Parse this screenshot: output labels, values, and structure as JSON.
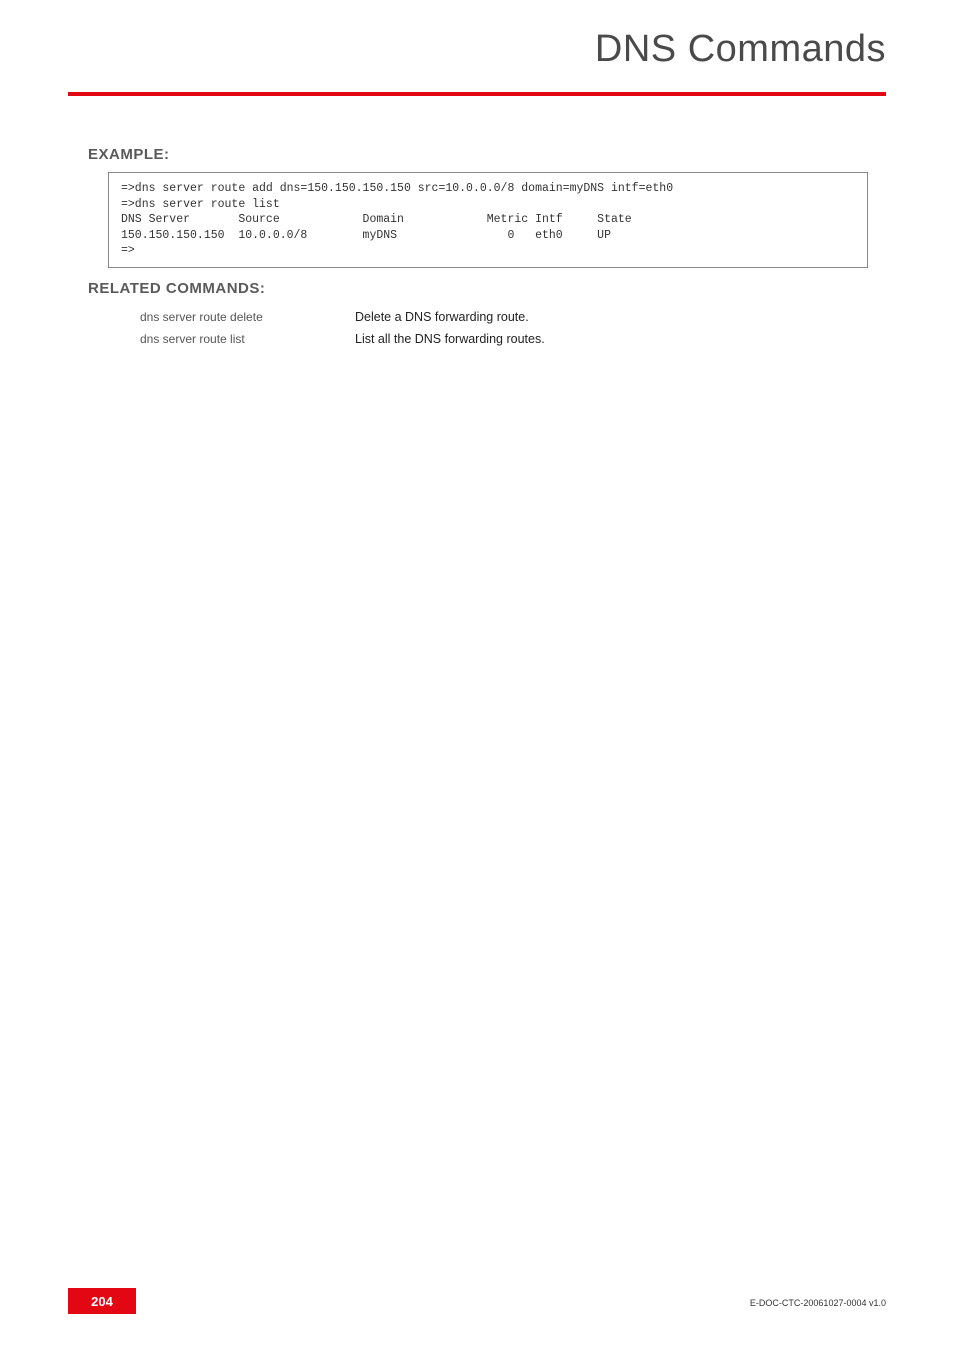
{
  "header": {
    "title": "DNS Commands"
  },
  "sections": {
    "example_heading": "EXAMPLE:",
    "related_heading": "RELATED COMMANDS:"
  },
  "code": {
    "line1": "=>dns server route add dns=150.150.150.150 src=10.0.0.0/8 domain=myDNS intf=eth0",
    "line2": "=>dns server route list",
    "line3": "DNS Server       Source            Domain            Metric Intf     State",
    "line4": "150.150.150.150  10.0.0.0/8        myDNS                0   eth0     UP",
    "line5": "=>"
  },
  "related": [
    {
      "cmd": "dns server route delete",
      "desc": "Delete a DNS forwarding route."
    },
    {
      "cmd": "dns server route list",
      "desc": "List all the DNS forwarding routes."
    }
  ],
  "footer": {
    "page_number": "204",
    "doc_id": "E-DOC-CTC-20061027-0004 v1.0"
  }
}
